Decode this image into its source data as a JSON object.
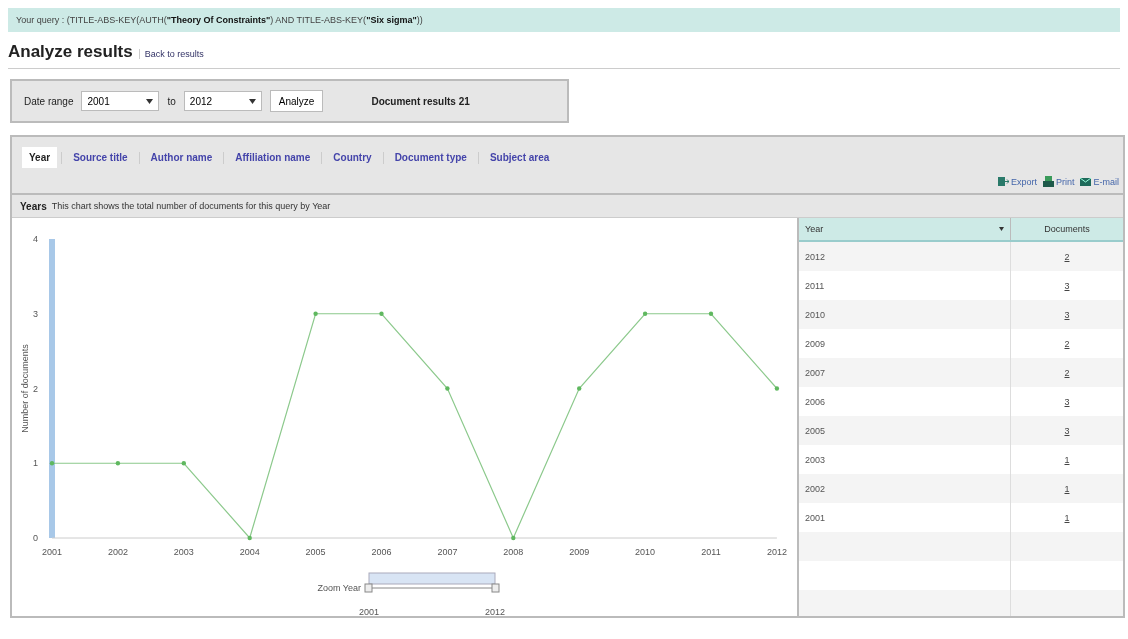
{
  "query": "Your query : (TITLE-ABS-KEY(AUTH(**\"Theory Of Constraints\"**) AND TITLE-ABS-KEY(**\"Six sigma\"**))",
  "header": {
    "title": "Analyze results",
    "back_link": "Back to results"
  },
  "filter": {
    "label": "Date range",
    "from": "2001",
    "to_label": "to",
    "to": "2012",
    "button": "Analyze",
    "result_count": "Document results 21"
  },
  "tabs": [
    {
      "label": "Year",
      "selected": true
    },
    {
      "label": "Source title",
      "selected": false
    },
    {
      "label": "Author name",
      "selected": false
    },
    {
      "label": "Affiliation name",
      "selected": false
    },
    {
      "label": "Country",
      "selected": false
    },
    {
      "label": "Document type",
      "selected": false
    },
    {
      "label": "Subject area",
      "selected": false
    }
  ],
  "actions": [
    {
      "kind": "export",
      "label": "Export"
    },
    {
      "kind": "print",
      "label": "Print"
    },
    {
      "kind": "email",
      "label": "E-mail"
    }
  ],
  "section": {
    "title": "Years",
    "description": "This chart shows the total number of documents for this query by Year"
  },
  "chart_data": {
    "type": "line",
    "ylabel": "Number of documents",
    "categories": [
      "2001",
      "2002",
      "2003",
      "2004",
      "2005",
      "2006",
      "2007",
      "2008",
      "2009",
      "2010",
      "2011",
      "2012"
    ],
    "series": [
      {
        "color": "#8cc98c",
        "values": [
          1,
          1,
          1,
          0,
          3,
          3,
          2,
          0,
          2,
          3,
          3,
          2
        ]
      }
    ],
    "bands": [
      {
        "axis": "x",
        "from": "2001",
        "to": "2001",
        "color": "#a8c8e8"
      }
    ],
    "ylim": [
      0,
      4
    ],
    "yticks": [
      0,
      1,
      2,
      3,
      4
    ]
  },
  "zoom": {
    "label": "Zoom Year",
    "from": "2001",
    "to": "2012"
  },
  "table": {
    "columns": [
      "Year",
      "Documents"
    ],
    "rows": [
      [
        "2012",
        "2"
      ],
      [
        "2011",
        "3"
      ],
      [
        "2010",
        "3"
      ],
      [
        "2009",
        "2"
      ],
      [
        "2007",
        "2"
      ],
      [
        "2006",
        "3"
      ],
      [
        "2005",
        "3"
      ],
      [
        "2003",
        "1"
      ],
      [
        "2002",
        "1"
      ],
      [
        "2001",
        "1"
      ]
    ]
  }
}
